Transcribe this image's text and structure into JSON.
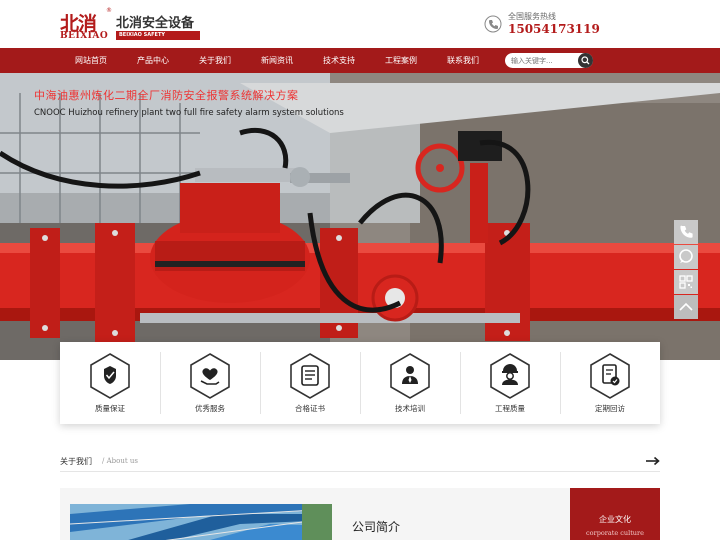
{
  "header": {
    "logo_cn": "北消",
    "logo_en": "BEIXIAO",
    "logo_reg": "®",
    "brand_cn": "北消安全设备",
    "brand_en": "BEIXIAO SAFETY PRODUCTS",
    "hotline_label": "全国服务热线",
    "hotline_number": "15054173119"
  },
  "nav": {
    "items": [
      "网站首页",
      "产品中心",
      "关于我们",
      "新闻资讯",
      "技术支持",
      "工程案例",
      "联系我们"
    ],
    "search_placeholder": "输入关键字..."
  },
  "banner": {
    "title": "中海油惠州炼化二期全厂消防安全报警系统解决方案",
    "subtitle": "CNOOC Huizhou refinery plant two full fire safety alarm system solutions"
  },
  "side_tools": [
    "phone-icon",
    "chat-icon",
    "qrcode-icon",
    "back-to-top-icon"
  ],
  "features": [
    {
      "label": "质量保证",
      "icon": "quality-shield-icon"
    },
    {
      "label": "优秀服务",
      "icon": "heart-hand-icon"
    },
    {
      "label": "合格证书",
      "icon": "certificate-icon"
    },
    {
      "label": "技术培训",
      "icon": "trainer-icon"
    },
    {
      "label": "工程质量",
      "icon": "engineer-icon"
    },
    {
      "label": "定期回访",
      "icon": "document-check-icon"
    }
  ],
  "about_section": {
    "title": "关于我们",
    "subtitle": "/ About us",
    "company_intro": "公司简介",
    "culture_cn": "企业文化",
    "culture_en": "corporate culture"
  },
  "colors": {
    "brand_red": "#a31a1a",
    "accent_red": "#b31b1b"
  }
}
